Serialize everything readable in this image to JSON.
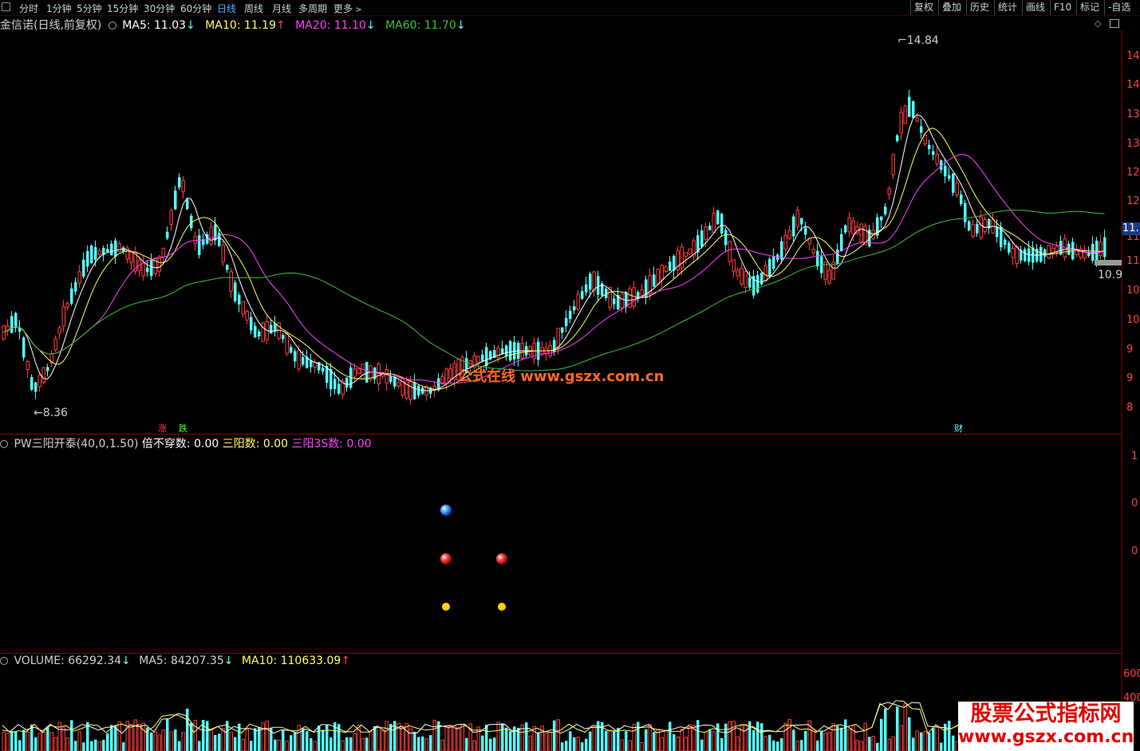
{
  "toolbar": {
    "periods": [
      "分时",
      "1分钟",
      "5分钟",
      "15分钟",
      "30分钟",
      "60分钟",
      "日线",
      "周线",
      "月线",
      "多周期",
      "更多"
    ],
    "active_period": "日线",
    "right_buttons": [
      "复权",
      "叠加",
      "历史",
      "统计",
      "画线",
      "F10",
      "标记",
      "-自选"
    ]
  },
  "main_panel": {
    "title": "金信诺(日线,前复权)",
    "ma5_label": "MA5: 11.03",
    "ma10_label": "MA10: 11.19",
    "ma20_label": "MA20: 11.10",
    "ma60_label": "MA60: 11.70",
    "arrow_down": "↓",
    "arrow_up": "↑",
    "high_label": "14.84",
    "low_label": "8.36",
    "last_label": "10.9",
    "current_price_tag": "11.",
    "marker_zhang": "涨",
    "marker_die": "跌",
    "marker_cai": "财",
    "axis_labels": [
      "14",
      "14",
      "13",
      "13",
      "12",
      "12",
      "11",
      "11",
      "10",
      "10",
      "9",
      "9",
      "8"
    ],
    "watermark": "公式在线  www.gszx.com.cn"
  },
  "indicator_panel": {
    "name": "PW三阳开泰(40,0,1.50)",
    "l1": "倍不穿数: 0.00",
    "l2": "三阳数: 0.00",
    "l3": "三阳3S数: 0.00",
    "axis_labels": [
      "1",
      "0",
      "0"
    ]
  },
  "volume_panel": {
    "vol_label": "VOLUME: 66292.34",
    "ma5_label": "MA5: 84207.35",
    "ma10_label": "MA10: 110633.09",
    "axis_labels": [
      "600",
      "400"
    ]
  },
  "watermark_bottom": {
    "line1": "股票公式指标网",
    "line2": "www.gszx.com.cn"
  },
  "colors": {
    "up": "#ff3b3b",
    "down": "#54ffff",
    "ma5": "#ffffff",
    "ma10": "#ffff60",
    "ma20": "#ff40ff",
    "ma60": "#40c040",
    "grid": "#8b0000"
  },
  "icons": [
    "menu-box-icon",
    "circle-toggle-icon",
    "chevron-right-icon",
    "arrow-down-icon",
    "arrow-up-icon"
  ]
}
